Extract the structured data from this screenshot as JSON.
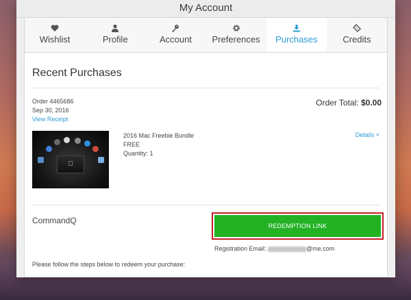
{
  "window": {
    "title": "My Account"
  },
  "tabs": [
    {
      "label": "Wishlist",
      "icon": "heart-icon"
    },
    {
      "label": "Profile",
      "icon": "user-icon"
    },
    {
      "label": "Account",
      "icon": "key-icon"
    },
    {
      "label": "Preferences",
      "icon": "gear-icon"
    },
    {
      "label": "Purchases",
      "icon": "download-icon",
      "active": true
    },
    {
      "label": "Credits",
      "icon": "ticket-icon"
    }
  ],
  "section_title": "Recent Purchases",
  "order": {
    "number": "Order 4465686",
    "date": "Sep 30, 2016",
    "receipt_link": "View Receipt",
    "total_label": "Order Total:",
    "total_value": "$0.00"
  },
  "product": {
    "name": "2016 Mac Freebie Bundle",
    "price": "FREE",
    "quantity": "Quantity: 1",
    "details_label": "Details ˅"
  },
  "app": {
    "name": "CommandQ",
    "redeem_label": "REDEMPTION LINK",
    "registration_label": "Registration Email:",
    "registration_email_suffix": "@me.com",
    "steps_text": "Please follow the steps below to redeem your purchase:"
  },
  "colors": {
    "accent": "#2d9bd6",
    "redeem_green": "#22b224",
    "highlight_red": "#c31d22"
  }
}
